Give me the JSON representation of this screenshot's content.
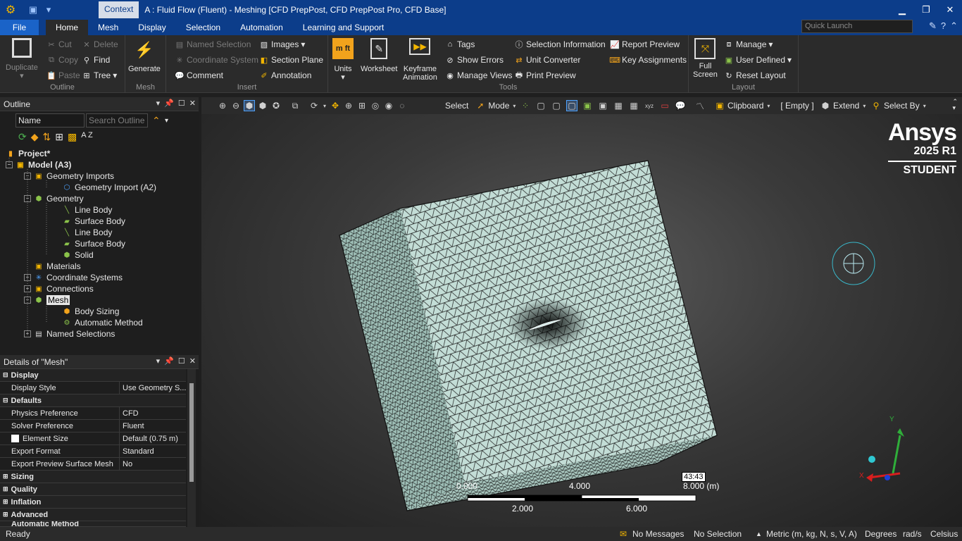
{
  "title": {
    "context_tab": "Context",
    "window_title": "A : Fluid Flow (Fluent) - Meshing [CFD PrepPost, CFD PrepPost Pro, CFD Base]"
  },
  "menu": {
    "file": "File",
    "tabs": [
      "Home",
      "Mesh",
      "Display",
      "Selection",
      "Automation",
      "Learning and Support"
    ],
    "quick_launch_placeholder": "Quick Launch"
  },
  "ribbon": {
    "outline_group": {
      "label": "Outline",
      "duplicate": "Duplicate",
      "cut": "Cut",
      "delete": "Delete",
      "copy": "Copy",
      "find": "Find",
      "paste": "Paste",
      "tree": "Tree"
    },
    "mesh_group": {
      "label": "Mesh",
      "generate": "Generate"
    },
    "insert_group": {
      "label": "Insert",
      "named_selection": "Named Selection",
      "coordinate_system": "Coordinate System",
      "comment": "Comment",
      "images": "Images",
      "section_plane": "Section Plane",
      "annotation": "Annotation"
    },
    "tools_group": {
      "label": "Tools",
      "units": "Units",
      "units_icon": "m ft",
      "worksheet": "Worksheet",
      "keyframe": "Keyframe",
      "animation": "Animation",
      "tags": "Tags",
      "show_errors": "Show Errors",
      "manage_views": "Manage Views",
      "selection_information": "Selection Information",
      "unit_converter": "Unit Converter",
      "print_preview": "Print Preview",
      "report_preview": "Report Preview",
      "key_assignments": "Key Assignments"
    },
    "layout_group": {
      "label": "Layout",
      "full": "Full",
      "screen": "Screen",
      "manage": "Manage",
      "user_defined": "User Defined",
      "reset_layout": "Reset Layout"
    }
  },
  "outline": {
    "title": "Outline",
    "filter": "Name",
    "search_placeholder": "Search Outline",
    "az": "A Z",
    "tree": [
      {
        "label": "Project*",
        "bold": true
      },
      {
        "label": "Model (A3)",
        "bold": true
      },
      {
        "label": "Geometry Imports"
      },
      {
        "label": "Geometry Import (A2)"
      },
      {
        "label": "Geometry"
      },
      {
        "label": "Line Body"
      },
      {
        "label": "Surface Body"
      },
      {
        "label": "Line Body"
      },
      {
        "label": "Surface Body"
      },
      {
        "label": "Solid"
      },
      {
        "label": "Materials"
      },
      {
        "label": "Coordinate Systems"
      },
      {
        "label": "Connections"
      },
      {
        "label": "Mesh",
        "selected": true
      },
      {
        "label": "Body Sizing"
      },
      {
        "label": "Automatic Method"
      },
      {
        "label": "Named Selections"
      }
    ]
  },
  "details": {
    "title": "Details of \"Mesh\"",
    "rows": [
      {
        "type": "cat",
        "key": "Display"
      },
      {
        "key": "Display Style",
        "value": "Use Geometry S..."
      },
      {
        "type": "cat",
        "key": "Defaults"
      },
      {
        "key": "Physics Preference",
        "value": "CFD"
      },
      {
        "key": "Solver Preference",
        "value": "Fluent"
      },
      {
        "key": "Element Size",
        "value": "Default (0.75 m)",
        "checkbox": true
      },
      {
        "key": "Export Format",
        "value": "Standard"
      },
      {
        "key": "Export Preview Surface Mesh",
        "value": "No"
      },
      {
        "type": "cat",
        "key": "Sizing"
      },
      {
        "type": "cat",
        "key": "Quality"
      },
      {
        "type": "cat",
        "key": "Inflation"
      },
      {
        "type": "cat",
        "key": "Advanced"
      },
      {
        "type": "cat",
        "key": "Automatic Method"
      }
    ]
  },
  "graphics_toolbar": {
    "select": "Select",
    "mode": "Mode",
    "clipboard": "Clipboard",
    "empty": "[ Empty ]",
    "extend": "Extend",
    "select_by": "Select By"
  },
  "viewport": {
    "brand": "Ansys",
    "version": "2025 R1",
    "edition": "STUDENT",
    "scale_top": [
      "0.000",
      "4.000",
      "8.000 (m)"
    ],
    "scale_bottom": [
      "2.000",
      "6.000"
    ],
    "timer": "43:43",
    "triad": {
      "x": "X",
      "y": "Y"
    },
    "colors": {
      "mesh_face": "#c3ddd6",
      "mesh_side": "#9dbdb5",
      "mesh_line": "#1a1a1a"
    }
  },
  "status": {
    "ready": "Ready",
    "messages": "No Messages",
    "selection": "No Selection",
    "units": "Metric (m, kg, N, s, V, A)",
    "angle": "Degrees",
    "rate": "rad/s",
    "temp": "Celsius"
  }
}
